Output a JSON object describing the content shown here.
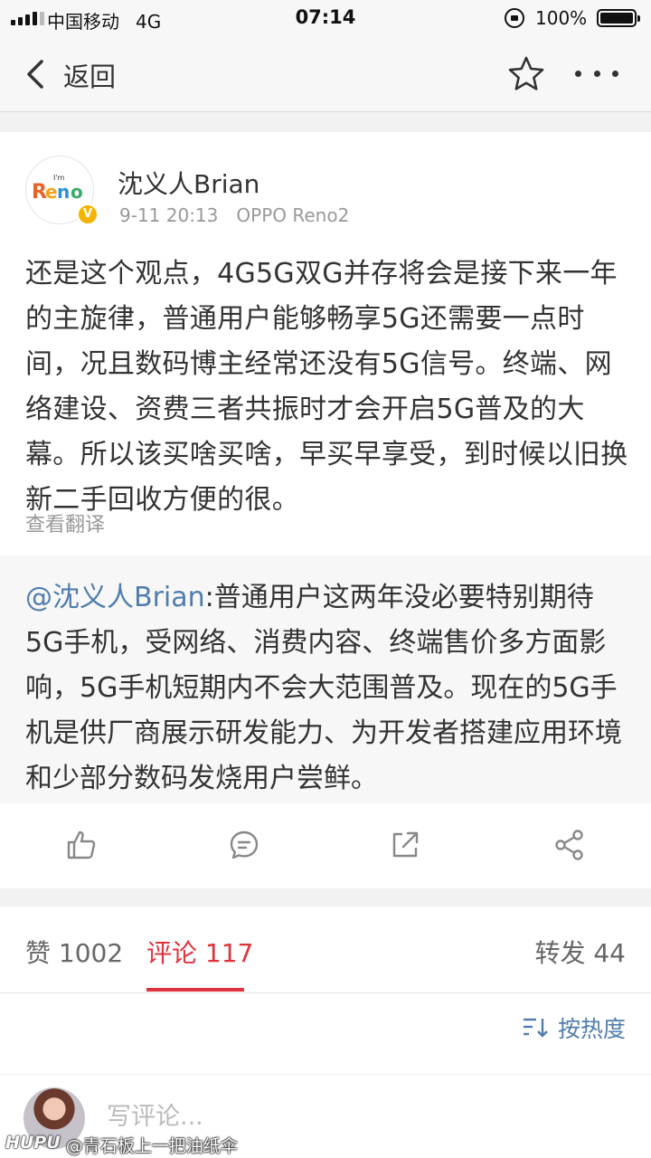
{
  "status_bar": {
    "carrier": "中国移动",
    "network": "4G",
    "time": "07:14",
    "battery": "100%"
  },
  "nav": {
    "back_label": "返回",
    "icons": [
      "chevron-left-icon",
      "star-icon",
      "more-icon"
    ]
  },
  "post": {
    "author": "沈义人Brian",
    "time": "9-11 20:13",
    "device": "OPPO Reno2",
    "avatar_text": "Reno",
    "avatar_small_text": "I'm",
    "body": "还是这个观点，4G5G双G并存将会是接下来一年的主旋律，普通用户能够畅享5G还需要一点时间，况且数码博主经常还没有5G信号。终端、网络建设、资费三者共振时才会开启5G普及的大幕。所以该买啥买啥，早买早享受，到时候以旧换新二手回收方便的很。",
    "translate": "查看翻译"
  },
  "repost": {
    "mention": "@沈义人Brian",
    "text": ":普通用户这两年没必要特别期待5G手机，受网络、消费内容、终端售价多方面影响，5G手机短期内不会大范围普及。现在的5G手机是供厂商展示研发能力、为开发者搭建应用环境和少部分数码发烧用户尝鲜。"
  },
  "actions": [
    "thumbs-up-icon",
    "comment-icon",
    "repost-icon",
    "share-icon"
  ],
  "tabs": {
    "likes": "赞 1002",
    "comments": "评论 117",
    "reposts": "转发 44"
  },
  "sort": {
    "label": "按热度"
  },
  "comment_box": {
    "placeholder": "写评论..."
  },
  "watermark": {
    "brand": "HUPU",
    "user": "@青石板上一把油纸伞"
  },
  "colors": {
    "accent_red": "#e0323c",
    "link_blue": "#507daf",
    "verified_yellow": "#f4b400"
  }
}
